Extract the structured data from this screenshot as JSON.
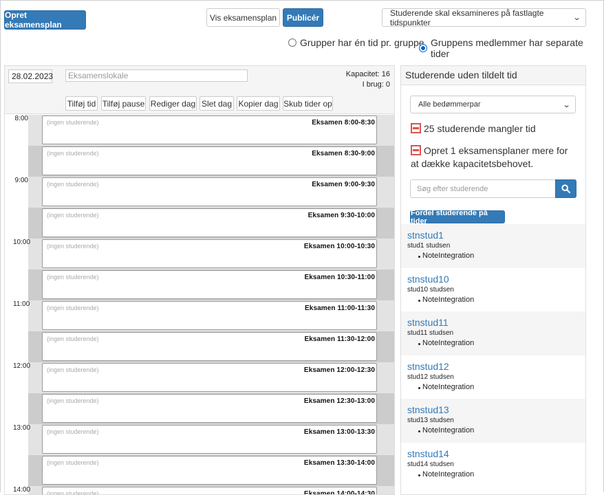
{
  "toolbar": {
    "create_label": "Opret eksamensplan",
    "view_label": "Vis eksamensplan",
    "publish_label": "Publicér",
    "mode_select": "Studerende skal eksamineres på fastlagte tidspunkter"
  },
  "radios": [
    {
      "label": "Grupper har én tid pr. gruppe",
      "checked": false
    },
    {
      "label": "Gruppens medlemmer har separate tider",
      "checked": true
    }
  ],
  "calendar": {
    "date": "28.02.2023",
    "room_placeholder": "Eksamenslokale",
    "capacity": "Kapacitet: 16",
    "in_use": "I brug: 0",
    "buttons": [
      "Tilføj tid",
      "Tilføj pause",
      "Rediger dag",
      "Slet dag",
      "Kopier dag",
      "Skub tider op"
    ],
    "hours": [
      "8:00",
      "9:00",
      "10:00",
      "11:00",
      "12:00",
      "13:00",
      "14:00"
    ],
    "empty_label": "(ingen studerende)",
    "slots": [
      "Eksamen  8:00-8:30",
      "Eksamen  8:30-9:00",
      "Eksamen  9:00-9:30",
      "Eksamen  9:30-10:00",
      "Eksamen  10:00-10:30",
      "Eksamen  10:30-11:00",
      "Eksamen  11:00-11:30",
      "Eksamen  11:30-12:00",
      "Eksamen  12:00-12:30",
      "Eksamen  12:30-13:00",
      "Eksamen  13:00-13:30",
      "Eksamen  13:30-14:00",
      "Eksamen  14:00-14:30"
    ]
  },
  "panel": {
    "title": "Studerende uden tildelt tid",
    "grader_select": "Alle bedømmerpar",
    "warn_missing": "25 studerende mangler tid",
    "warn_capacity": "Opret 1 eksamensplaner mere for at dække kapacitetsbehovet.",
    "search_placeholder": "Søg efter studerende",
    "assign_label": "Fordel studerende på tider",
    "students": [
      {
        "name": "stnstud1",
        "full": "stud1 studsen",
        "note": "NoteIntegration"
      },
      {
        "name": "stnstud10",
        "full": "stud10 studsen",
        "note": "NoteIntegration"
      },
      {
        "name": "stnstud11",
        "full": "stud11 studsen",
        "note": "NoteIntegration"
      },
      {
        "name": "stnstud12",
        "full": "stud12 studsen",
        "note": "NoteIntegration"
      },
      {
        "name": "stnstud13",
        "full": "stud13 studsen",
        "note": "NoteIntegration"
      },
      {
        "name": "stnstud14",
        "full": "stud14 studsen",
        "note": "NoteIntegration"
      }
    ]
  },
  "colors": {
    "primary": "#337ab7",
    "warning": "#d9534f",
    "slot_shade_dark": "#cccccc",
    "slot_shade_light": "#e3e3e3"
  }
}
